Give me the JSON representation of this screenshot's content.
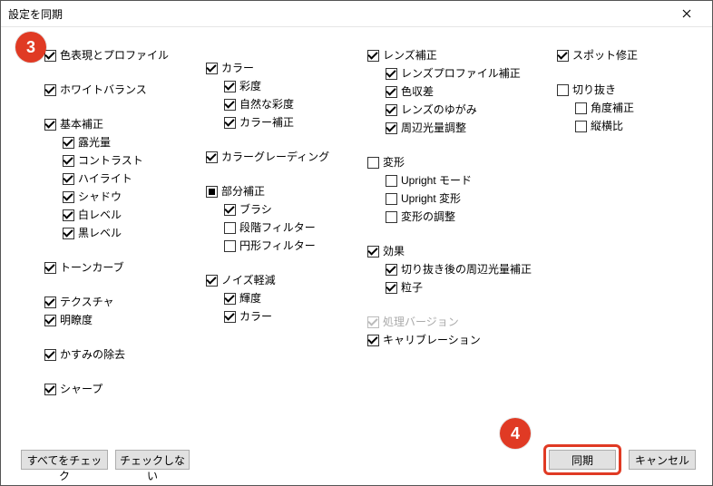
{
  "title": "設定を同期",
  "badges": {
    "b3": "3",
    "b4": "4"
  },
  "col1": {
    "colorProfile": "色表現とプロファイル",
    "whiteBalance": "ホワイトバランス",
    "basic": "基本補正",
    "exposure": "露光量",
    "contrast": "コントラスト",
    "highlight": "ハイライト",
    "shadow": "シャドウ",
    "whiteLevel": "白レベル",
    "blackLevel": "黒レベル",
    "toneCurve": "トーンカーブ",
    "texture": "テクスチャ",
    "clarity": "明瞭度",
    "dehaze": "かすみの除去",
    "sharp": "シャープ"
  },
  "col2": {
    "color": "カラー",
    "saturation": "彩度",
    "vibrance": "自然な彩度",
    "colorCorrection": "カラー補正",
    "colorGrading": "カラーグレーディング",
    "local": "部分補正",
    "brush": "ブラシ",
    "gradFilter": "段階フィルター",
    "radialFilter": "円形フィルター",
    "noise": "ノイズ軽減",
    "luminance": "輝度",
    "colorNoise": "カラー"
  },
  "col3": {
    "lens": "レンズ補正",
    "lensProfile": "レンズプロファイル補正",
    "chroma": "色収差",
    "distortion": "レンズのゆがみ",
    "vignette": "周辺光量調整",
    "transform": "変形",
    "uprightMode": "Upright モード",
    "uprightTransform": "Upright 変形",
    "transformAdjust": "変形の調整",
    "effects": "効果",
    "postCropVignette": "切り抜き後の周辺光量補正",
    "grain": "粒子",
    "processVersion": "処理バージョン",
    "calibration": "キャリブレーション"
  },
  "col4": {
    "spot": "スポット修正",
    "crop": "切り抜き",
    "angle": "角度補正",
    "aspect": "縦横比"
  },
  "buttons": {
    "checkAll": "すべてをチェック",
    "checkNone": "チェックしない",
    "sync": "同期",
    "cancel": "キャンセル"
  }
}
